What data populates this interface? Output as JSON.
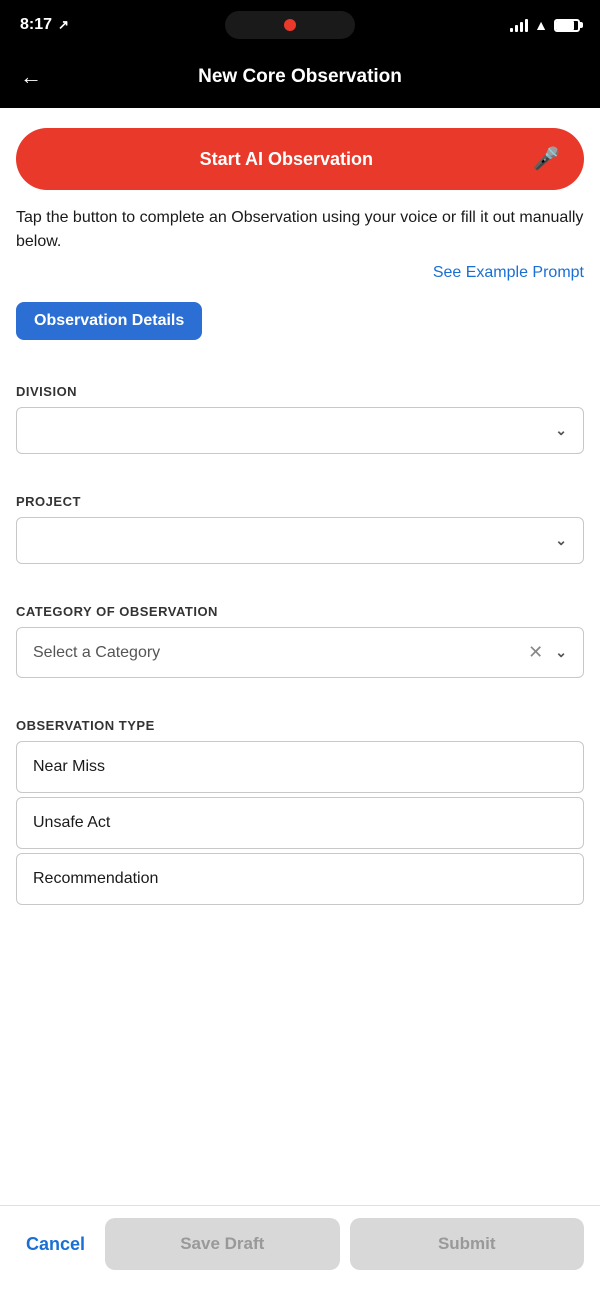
{
  "statusBar": {
    "time": "8:17",
    "arrow": "↗"
  },
  "header": {
    "backLabel": "←",
    "title": "New Core Observation"
  },
  "aiButton": {
    "label": "Start AI Observation",
    "micIcon": "🎤"
  },
  "description": "Tap the button to complete an Observation using your voice or fill it out manually below.",
  "examplePromptLink": "See Example Prompt",
  "observationDetailsBadge": "Observation Details",
  "form": {
    "division": {
      "label": "DIVISION",
      "placeholder": "",
      "value": ""
    },
    "project": {
      "label": "PROJECT",
      "placeholder": "",
      "value": ""
    },
    "category": {
      "label": "CATEGORY OF OBSERVATION",
      "placeholder": "Select a Category",
      "value": "Select a Category"
    },
    "observationType": {
      "label": "OBSERVATION TYPE",
      "options": [
        "Near Miss",
        "Unsafe Act",
        "Recommendation"
      ]
    }
  },
  "bottomBar": {
    "cancelLabel": "Cancel",
    "saveDraftLabel": "Save Draft",
    "submitLabel": "Submit"
  }
}
